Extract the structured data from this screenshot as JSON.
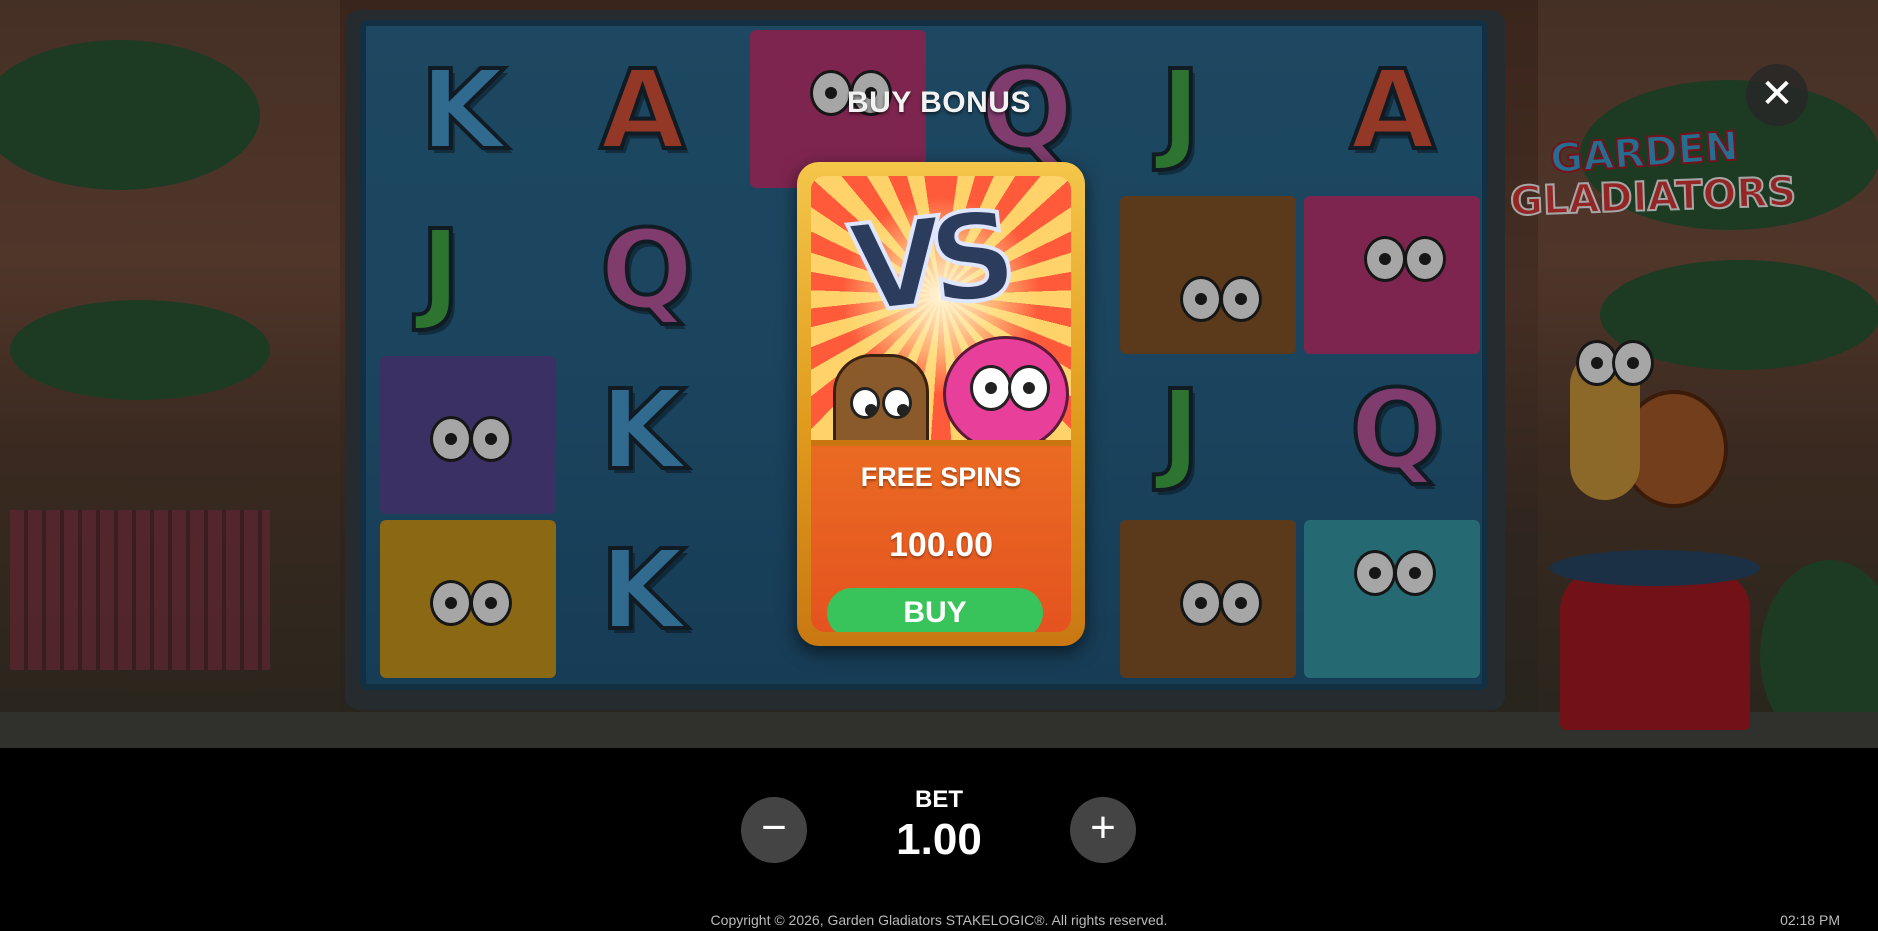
{
  "game": {
    "logo_line1": "GARDEN",
    "logo_line2": "GLADIATORS"
  },
  "reels": {
    "letters": [
      {
        "char": "K",
        "color": "blue"
      },
      {
        "char": "A",
        "color": "red"
      },
      {
        "char": "Q",
        "color": "pink"
      },
      {
        "char": "J",
        "color": "green"
      },
      {
        "char": "A",
        "color": "red"
      },
      {
        "char": "J",
        "color": "green"
      },
      {
        "char": "Q",
        "color": "pink"
      },
      {
        "char": "K",
        "color": "blue"
      },
      {
        "char": "J",
        "color": "green"
      },
      {
        "char": "Q",
        "color": "pink"
      },
      {
        "char": "K",
        "color": "blue"
      }
    ]
  },
  "dialog": {
    "title": "BUY BONUS",
    "card": {
      "art_text": "VS",
      "label": "FREE SPINS",
      "price": "100.00",
      "buy_label": "BUY"
    },
    "close_symbol": "✕"
  },
  "bet": {
    "label": "BET",
    "value": "1.00",
    "minus_symbol": "−",
    "plus_symbol": "+"
  },
  "footer": {
    "copyright": "Copyright © 2026, Garden Gladiators STAKELOGIC®. All rights reserved.",
    "time": "02:18 PM"
  },
  "icons": {
    "close": "close-icon",
    "minus": "minus-icon",
    "plus": "plus-icon"
  },
  "colors": {
    "buy_button": "#38c45a",
    "card_frame": "#e09a1c",
    "card_body": "#ea6a22"
  }
}
